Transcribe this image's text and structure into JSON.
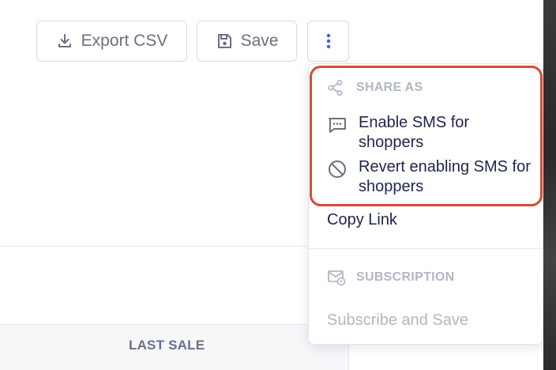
{
  "toolbar": {
    "export_label": "Export CSV",
    "save_label": "Save"
  },
  "table": {
    "column_header": "LAST SALE"
  },
  "menu": {
    "share_section": "SHARE AS",
    "items": [
      {
        "label": "Enable SMS for shoppers",
        "icon": "message-icon"
      },
      {
        "label": "Revert enabling SMS for shoppers",
        "icon": "block-icon"
      },
      {
        "label": "Copy Link"
      }
    ],
    "subscription_section": "SUBSCRIPTION",
    "subscribe_label": "Subscribe and Save"
  },
  "colors": {
    "highlight": "#d94a34",
    "text": "#1f2450",
    "muted": "#b3b6c4",
    "accent": "#3d5afe"
  }
}
